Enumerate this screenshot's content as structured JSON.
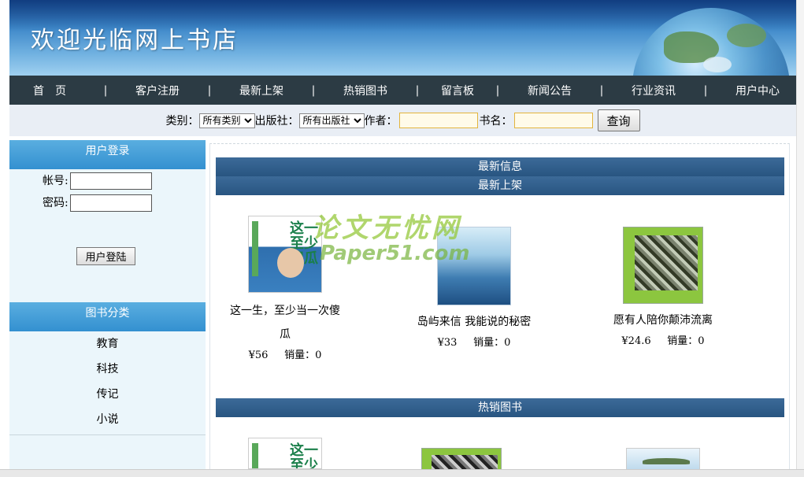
{
  "banner": {
    "title": "欢迎光临网上书店"
  },
  "nav": {
    "items": [
      "首　页",
      "客户注册",
      "最新上架",
      "热销图书",
      "留言板",
      "新闻公告",
      "行业资讯",
      "用户中心"
    ],
    "separator": "|"
  },
  "search": {
    "category_label": "类别：",
    "category_selected": "所有类别",
    "publisher_label": "出版社：",
    "publisher_selected": "所有出版社",
    "author_label": "作者：",
    "title_label": "书名：",
    "button": "查询"
  },
  "sidebar": {
    "login_title": "用户登录",
    "account_label": "帐号:",
    "password_label": "密码:",
    "login_button": "用户登陆",
    "category_title": "图书分类",
    "categories": [
      "教育",
      "科技",
      "传记",
      "小说"
    ]
  },
  "main": {
    "latest_info": "最新信息",
    "new_arrivals": "最新上架",
    "hot_books": "热销图书",
    "books": [
      {
        "name_line1": "这一生，至少当一次傻",
        "name_line2": "瓜",
        "price": "¥56",
        "sales": "销量：0"
      },
      {
        "name": "岛屿来信 我能说的秘密",
        "price": "¥33",
        "sales": "销量：0"
      },
      {
        "name": "愿有人陪你颠沛流离",
        "price": "¥24.6",
        "sales": "销量：0"
      }
    ],
    "cover_text": "这一生至少当一次傻瓜"
  },
  "watermark": {
    "line1": "论文无忧网",
    "line2": "Paper51.com"
  }
}
